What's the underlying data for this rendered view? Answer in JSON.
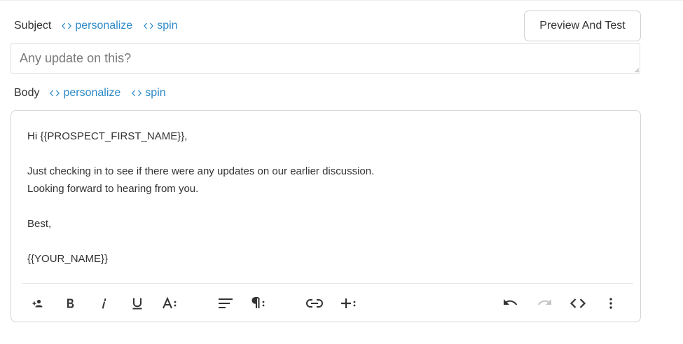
{
  "subject": {
    "label": "Subject",
    "personalize_label": "personalize",
    "spin_label": "spin",
    "placeholder": "Any update on this?"
  },
  "preview_button_label": "Preview And Test",
  "body": {
    "label": "Body",
    "personalize_label": "personalize",
    "spin_label": "spin",
    "lines": {
      "greeting": "Hi {{PROSPECT_FIRST_NAME}},",
      "line1": "Just checking in to see if there were any updates on our earlier discussion.",
      "line2": "Looking forward to hearing from you.",
      "signoff": "Best,",
      "signature": "{{YOUR_NAME}}"
    }
  },
  "toolbar": {
    "icons": [
      "add-person-icon",
      "bold-icon",
      "italic-icon",
      "underline-icon",
      "font-size-icon",
      "align-icon",
      "paragraph-icon",
      "link-icon",
      "insert-icon",
      "undo-icon",
      "redo-icon",
      "code-view-icon",
      "more-icon"
    ],
    "redo_disabled": true
  },
  "colors": {
    "accent_link": "#2d8ac8",
    "icon": "#333333",
    "icon_disabled": "#c4c4c4"
  }
}
